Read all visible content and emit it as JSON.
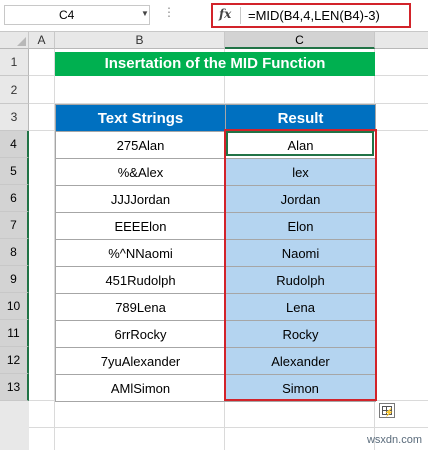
{
  "formula_bar": {
    "name_box": "C4",
    "dots": "⋮",
    "fx": "fx",
    "formula": "=MID(B4,4,LEN(B4)-3)"
  },
  "columns": [
    "A",
    "B",
    "C"
  ],
  "rows": [
    "1",
    "2",
    "3",
    "4",
    "5",
    "6",
    "7",
    "8",
    "9",
    "10",
    "11",
    "12",
    "13"
  ],
  "sheet": {
    "title": "Insertation of the MID Function",
    "headers": {
      "text": "Text Strings",
      "result": "Result"
    },
    "data": [
      {
        "text": "275Alan",
        "result": "Alan"
      },
      {
        "text": "%&Alex",
        "result": "lex"
      },
      {
        "text": "JJJJordan",
        "result": "Jordan"
      },
      {
        "text": "EEEElon",
        "result": "Elon"
      },
      {
        "text": "%^NNaomi",
        "result": "Naomi"
      },
      {
        "text": "451Rudolph",
        "result": "Rudolph"
      },
      {
        "text": "789Lena",
        "result": "Lena"
      },
      {
        "text": "6rrRocky",
        "result": "Rocky"
      },
      {
        "text": "7yuAlexander",
        "result": "Alexander"
      },
      {
        "text": "AMlSimon",
        "result": "Simon"
      }
    ]
  },
  "watermark": "wsxdn.com",
  "colors": {
    "title_fill": "#00b050",
    "header_fill": "#0070c0",
    "result_fill": "#b4d4f0",
    "highlight": "#d2232a"
  }
}
